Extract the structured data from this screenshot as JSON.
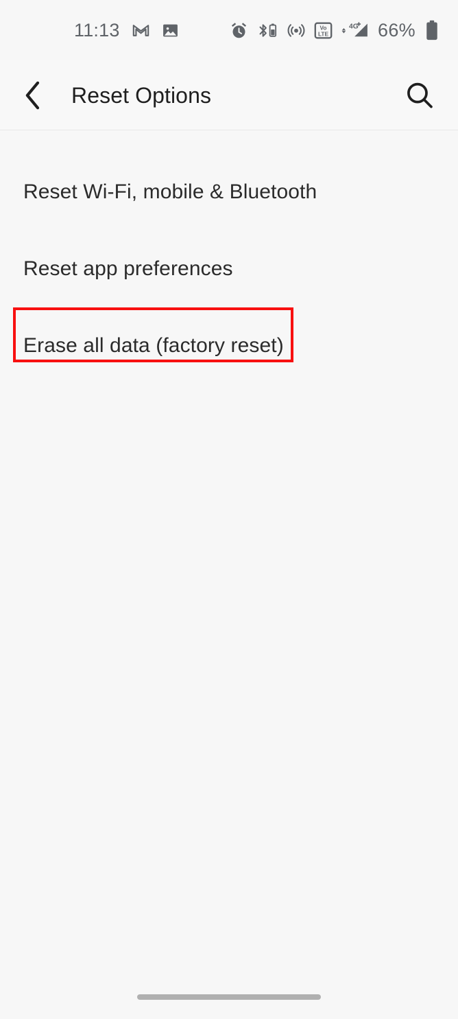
{
  "status_bar": {
    "time": "11:13",
    "battery_percent": "66%",
    "left_icons": [
      {
        "name": "gmail-icon",
        "label": "Gmail notification"
      },
      {
        "name": "photo-icon",
        "label": "Screenshot notification"
      }
    ],
    "right_icons": [
      {
        "name": "alarm-clock-icon",
        "label": "Alarm set"
      },
      {
        "name": "bluetooth-battery-icon",
        "label": "Bluetooth device battery"
      },
      {
        "name": "hotspot-icon",
        "label": "Hotspot"
      },
      {
        "name": "volte-icon",
        "label": "VoLTE"
      },
      {
        "name": "signal-4g-plus-icon",
        "label": "4G+ signal"
      },
      {
        "name": "battery-icon",
        "label": "Battery"
      }
    ],
    "volte_top": "Vo",
    "volte_bottom": "LTE",
    "network_label": "4G",
    "network_plus": "+",
    "icon_color": "#5f6368"
  },
  "app_bar": {
    "title": "Reset Options",
    "back_icon": "chevron-left-icon",
    "search_icon": "search-icon",
    "title_color": "#1f1f1f"
  },
  "list": {
    "items": [
      {
        "label": "Reset Wi-Fi, mobile & Bluetooth",
        "highlighted": false
      },
      {
        "label": "Reset app preferences",
        "highlighted": false
      },
      {
        "label": "Erase all data (factory reset)",
        "highlighted": true
      }
    ]
  },
  "annotation": {
    "target_label": "Erase all data (factory reset)",
    "color": "#f81010",
    "border_width_px": 4
  },
  "nav_bar": {
    "gesture_pill": "home-gesture-pill",
    "pill_color": "#b0b0b0"
  },
  "theme": {
    "background": "#f7f7f7",
    "app_bar_background": "#f8f8f8",
    "text_primary": "#2b2b2b",
    "text_secondary": "#5f6368"
  }
}
